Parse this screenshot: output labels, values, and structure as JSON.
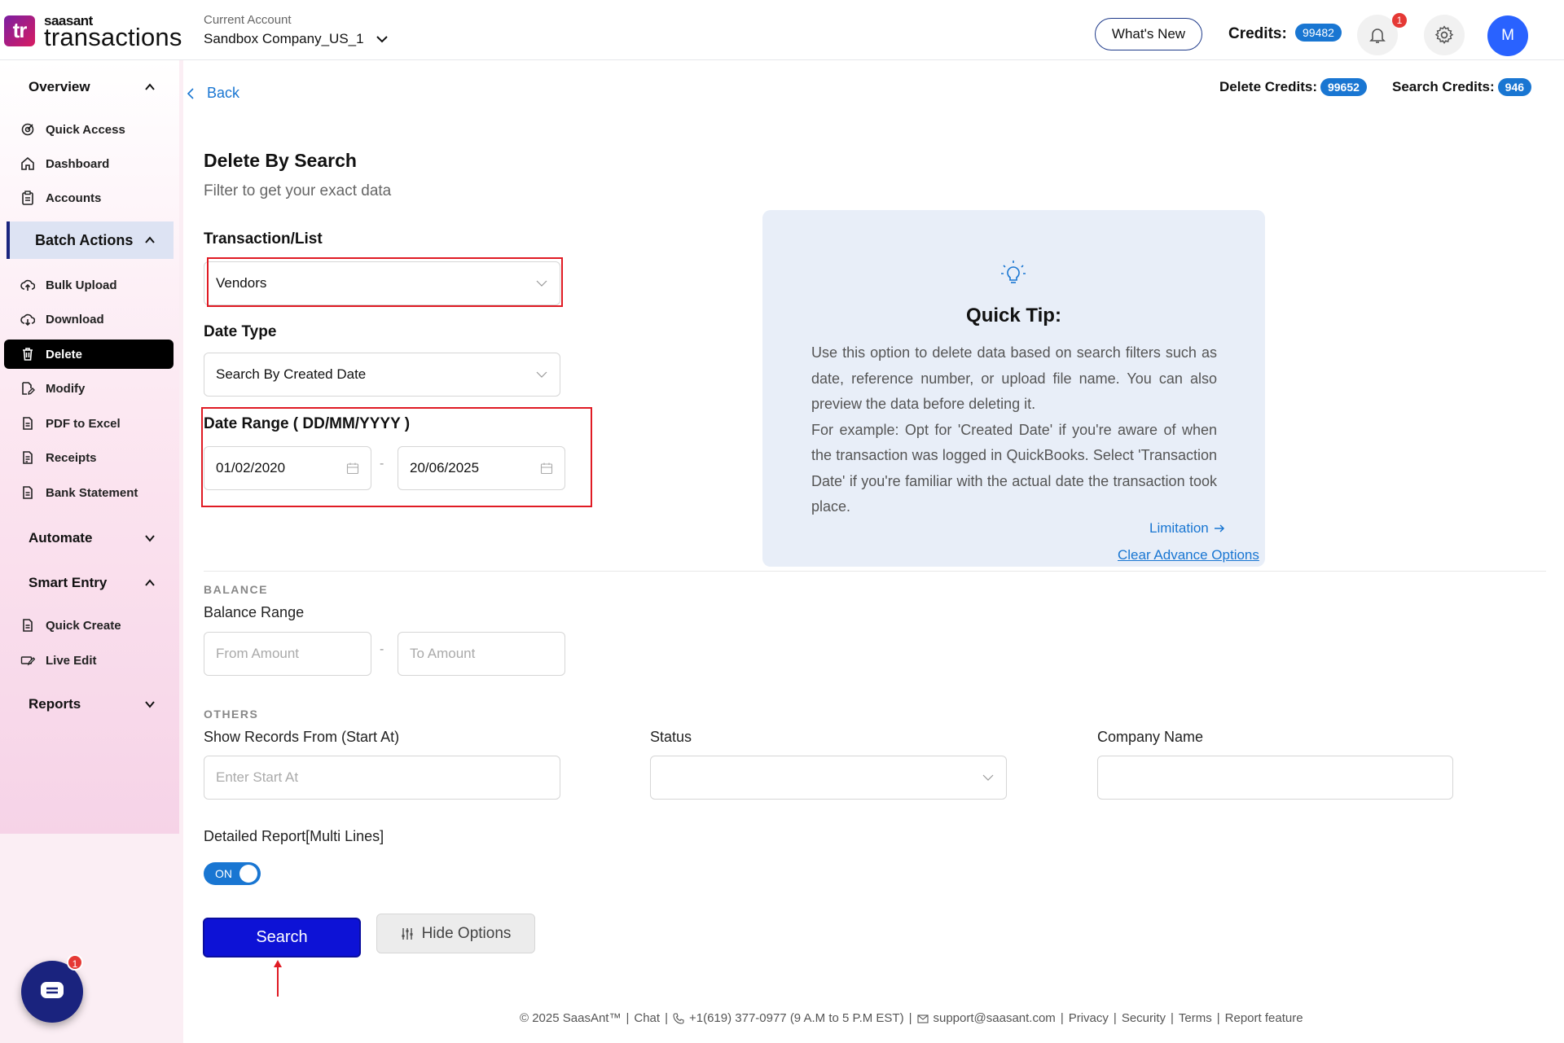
{
  "brand": {
    "logo_mark": "tr",
    "small": "saasant",
    "big": "transactions"
  },
  "account": {
    "caption": "Current Account",
    "name": "Sandbox Company_US_1"
  },
  "header": {
    "whats_new": "What's New",
    "credits_label": "Credits:",
    "credits_value": "99482",
    "notification_count": "1",
    "avatar_initial": "M"
  },
  "sidebar": {
    "overview": "Overview",
    "overview_items": [
      "Quick Access",
      "Dashboard",
      "Accounts"
    ],
    "batch_actions": "Batch Actions",
    "batch_items": [
      "Bulk Upload",
      "Download",
      "Delete",
      "Modify",
      "PDF to Excel",
      "Receipts",
      "Bank Statement"
    ],
    "automate": "Automate",
    "smart_entry": "Smart Entry",
    "smart_items": [
      "Quick Create",
      "Live Edit"
    ],
    "reports": "Reports",
    "chat_badge": "1"
  },
  "main": {
    "back": "Back",
    "delete_credits_label": "Delete Credits:",
    "delete_credits_value": "99652",
    "search_credits_label": "Search Credits:",
    "search_credits_value": "946",
    "title": "Delete By Search",
    "subtitle": "Filter to get your exact data",
    "transaction_label": "Transaction/List",
    "transaction_value": "Vendors",
    "date_type_label": "Date Type",
    "date_type_value": "Search By Created Date",
    "date_range_label": "Date Range ( DD/MM/YYYY )",
    "date_from": "01/02/2020",
    "date_to": "20/06/2025",
    "range_separator": "-",
    "balance_head": "BALANCE",
    "balance_label": "Balance Range",
    "from_amount_placeholder": "From Amount",
    "to_amount_placeholder": "To Amount",
    "others_head": "OTHERS",
    "start_at_label": "Show Records From (Start At)",
    "start_at_placeholder": "Enter Start At",
    "status_label": "Status",
    "company_label": "Company Name",
    "detailed_label": "Detailed Report[Multi Lines]",
    "toggle_text": "ON",
    "search_button": "Search",
    "hide_button": "Hide Options"
  },
  "tip": {
    "title": "Quick Tip:",
    "body": "Use this option to delete data based on search filters such as date, reference number, or upload file name. You can also preview the data before deleting it.",
    "example": "For example: Opt for 'Created Date' if you're aware of when the transaction was logged in QuickBooks. Select 'Transaction Date' if you're familiar with the actual date the transaction took place.",
    "limitation": "Limitation",
    "clear": "Clear Advance Options"
  },
  "footer": {
    "copyright": "© 2025 SaasAnt™",
    "chat": "Chat",
    "phone": "+1(619) 377-0977 (9 A.M to 5 P.M EST)",
    "email": "support@saasant.com",
    "privacy": "Privacy",
    "security": "Security",
    "terms": "Terms",
    "report": "Report feature"
  },
  "colors": {
    "accent": "#1976d2",
    "primary_button": "#0d12d6",
    "annotation_red": "#e01b24",
    "selected_nav": "#000000"
  }
}
